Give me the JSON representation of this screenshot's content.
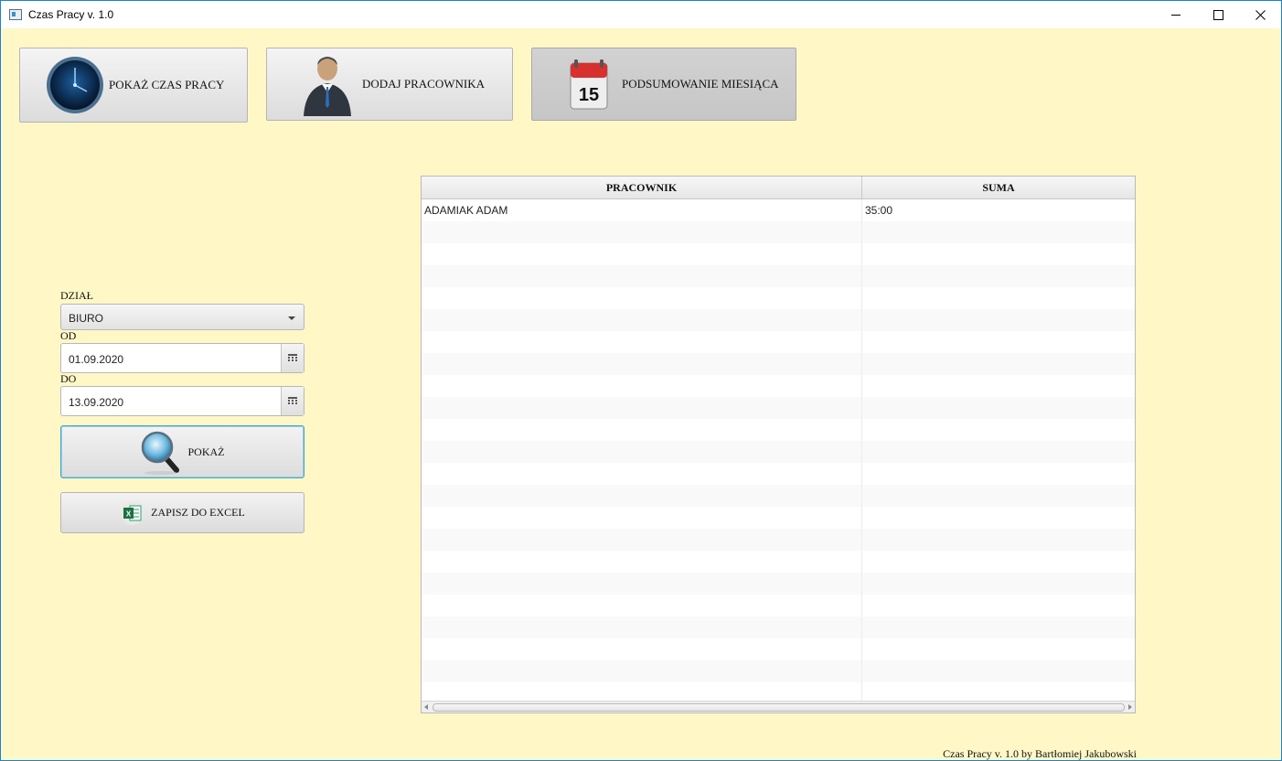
{
  "window": {
    "title": "Czas Pracy v. 1.0"
  },
  "toolbar": {
    "show_time_label": "POKAŻ CZAS PRACY",
    "add_employee_label": "DODAJ PRACOWNIKA",
    "month_summary_label": "PODSUMOWANIE MIESIĄCA",
    "calendar_day": "15"
  },
  "filters": {
    "department_label": "DZIAŁ",
    "department_value": "BIURO",
    "from_label": "OD",
    "from_value": "01.09.2020",
    "to_label": "DO",
    "to_value": "13.09.2020",
    "show_label": "POKAŻ",
    "excel_label": "ZAPISZ DO EXCEL"
  },
  "table": {
    "headers": [
      "PRACOWNIK",
      "SUMA"
    ],
    "rows": [
      {
        "employee": "ADAMIAK ADAM",
        "total": "35:00"
      }
    ]
  },
  "footer": {
    "credit": "Czas Pracy v. 1.0 by Bartłomiej Jakubowski"
  }
}
